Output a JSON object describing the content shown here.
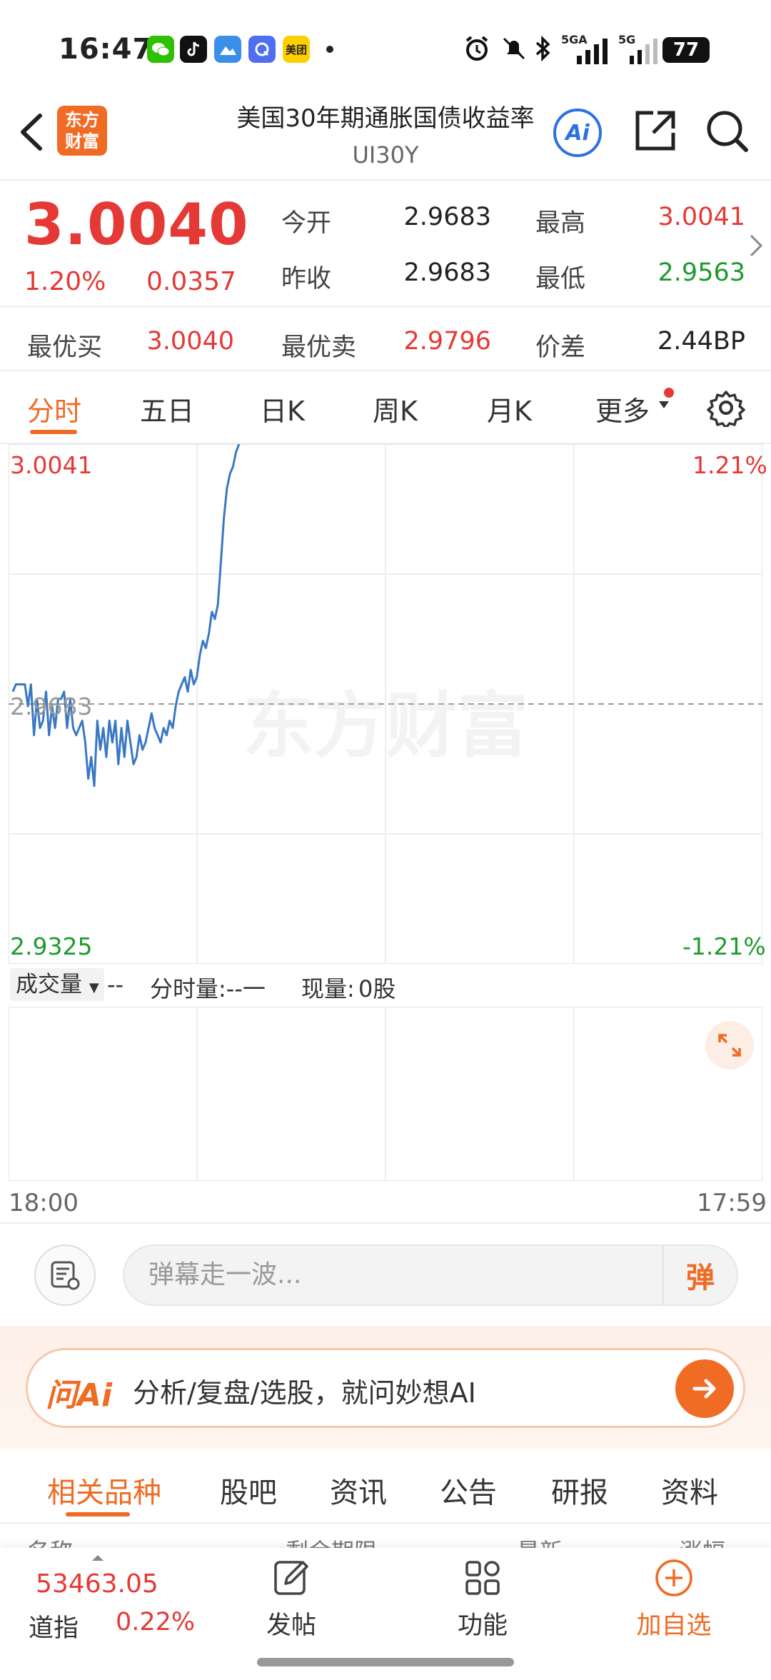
{
  "status_bar": {
    "time": "16:47",
    "apps": [
      "wechat-icon",
      "tiktok-icon",
      "weather-icon",
      "quark-icon",
      "meituan-icon"
    ],
    "meituan_text": "美团",
    "signal_1": "5GA",
    "signal_2": "5G",
    "battery": "77"
  },
  "nav": {
    "logo_line1": "东方",
    "logo_line2": "财富",
    "title": "美国30年期通胀国债收益率",
    "code": "UI30Y",
    "ai_label": "Ai"
  },
  "quote": {
    "price": "3.0040",
    "change_pct": "1.20%",
    "change_abs": "0.0357",
    "open_label": "今开",
    "open": "2.9683",
    "high_label": "最高",
    "high": "3.0041",
    "prev_close_label": "昨收",
    "prev_close": "2.9683",
    "low_label": "最低",
    "low": "2.9563",
    "best_bid_label": "最优买",
    "best_bid": "3.0040",
    "best_ask_label": "最优卖",
    "best_ask": "2.9796",
    "spread_label": "价差",
    "spread": "2.44BP"
  },
  "tabs": [
    "分时",
    "五日",
    "日K",
    "周K",
    "月K",
    "更多"
  ],
  "chart": {
    "y_top": "3.0041",
    "y_mid": "2.9683",
    "y_bottom": "2.9325",
    "pct_top": "1.21%",
    "pct_bottom": "-1.21%",
    "watermark": "东方财富",
    "x_start": "18:00",
    "x_end": "17:59"
  },
  "chart_data": {
    "type": "line",
    "series": [
      {
        "values": [
          2.97,
          2.971,
          2.971,
          2.971,
          2.971,
          2.968,
          2.971,
          2.964,
          2.969,
          2.965,
          2.966,
          2.97,
          2.964,
          2.968,
          2.965,
          2.969,
          2.969,
          2.97,
          2.965,
          2.969,
          2.965,
          2.964,
          2.965,
          2.966,
          2.963,
          2.958,
          2.961,
          2.957,
          2.966,
          2.962,
          2.965,
          2.961,
          2.966,
          2.963,
          2.966,
          2.96,
          2.965,
          2.961,
          2.966,
          2.963,
          2.96,
          2.961,
          2.964,
          2.962,
          2.963,
          2.965,
          2.967,
          2.965,
          2.964,
          2.963,
          2.965,
          2.964,
          2.966,
          2.965,
          2.968,
          2.97,
          2.971,
          2.972,
          2.97,
          2.973,
          2.971,
          2.972,
          2.975,
          2.977,
          2.976,
          2.978,
          2.981,
          2.98,
          2.982,
          2.988,
          2.994,
          2.998,
          3.0,
          3.001,
          3.003,
          3.0041
        ]
      },
      {
        "name": "prev_close",
        "values": [
          2.9683
        ]
      }
    ],
    "ylim": [
      2.9325,
      3.0041
    ],
    "grid": true
  },
  "volume": {
    "selector": "成交量",
    "dash": "--",
    "tick_vol_label": "分时量:--一",
    "now_vol_label": "现量:",
    "now_vol": "0股"
  },
  "danmaku": {
    "placeholder": "弹幕走一波...",
    "send": "弹"
  },
  "ai_bar": {
    "brand": "问Ai",
    "text": "分析/复盘/选股，就问妙想AI"
  },
  "bottom_tabs": [
    "相关品种",
    "股吧",
    "资讯",
    "公告",
    "研报",
    "资料"
  ],
  "list_header": {
    "col1": "名称",
    "col2": "剩余期限",
    "col3": "最新",
    "col4": "涨幅"
  },
  "bottom_bar": {
    "index_value": "53463.05",
    "index_name": "道指",
    "index_change": "0.22%",
    "post": "发帖",
    "functions": "功能",
    "add_watch": "加自选"
  },
  "colors": {
    "accent": "#f06b24",
    "up": "#e53935",
    "down": "#1e9b2e",
    "line": "#3a78c3"
  }
}
